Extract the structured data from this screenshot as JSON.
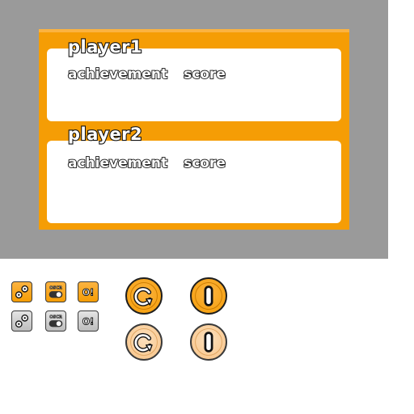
{
  "player1": {
    "name": "player1"
  },
  "player2": {
    "name": "player2"
  },
  "columns": {
    "achievement": "achievement",
    "score": "score"
  },
  "small_buttons": {
    "toggle_label": "OSCR",
    "alert_label": "O!"
  },
  "colors": {
    "backdrop": "#9a9a9a",
    "panel_orange": "#f59d05",
    "panel_light": "#fbb341",
    "card": "#ffffff",
    "outline": "#111111",
    "disabled_grey": "#bdbdbd",
    "faded_orange": "#f8c284"
  },
  "icons": [
    "achievements-icon",
    "toggle-icon",
    "alert-icon",
    "replay-icon",
    "pause-icon"
  ]
}
